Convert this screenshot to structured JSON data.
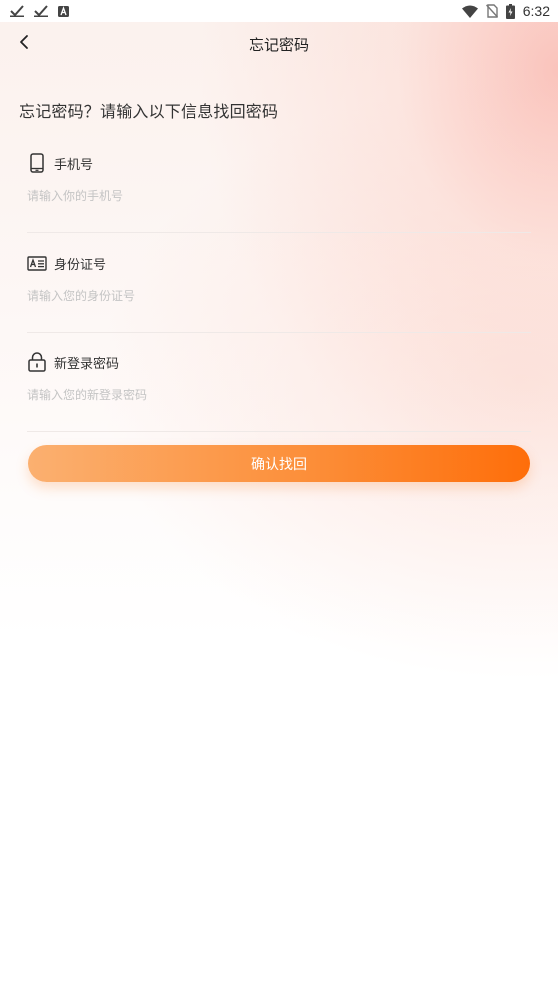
{
  "status_bar": {
    "time": "6:32",
    "left_icons": [
      "check-icon",
      "check-icon",
      "a-badge-icon"
    ],
    "right_icons": [
      "wifi-icon",
      "no-sim-icon",
      "battery-icon"
    ]
  },
  "nav": {
    "title": "忘记密码",
    "back_icon": "chevron-left-icon"
  },
  "heading": "忘记密码？请输入以下信息找回密码",
  "fields": [
    {
      "label": "手机号",
      "icon": "phone-icon",
      "placeholder": "请输入你的手机号",
      "value": ""
    },
    {
      "label": "身份证号",
      "icon": "id-card-icon",
      "placeholder": "请输入您的身份证号",
      "value": ""
    },
    {
      "label": "新登录密码",
      "icon": "lock-icon",
      "placeholder": "请输入您的新登录密码",
      "value": ""
    }
  ],
  "confirm_button": "确认找回",
  "colors": {
    "accent_start": "#fbb070",
    "accent_end": "#fe6e0a",
    "text": "#333333",
    "placeholder": "#c4c4c4"
  }
}
